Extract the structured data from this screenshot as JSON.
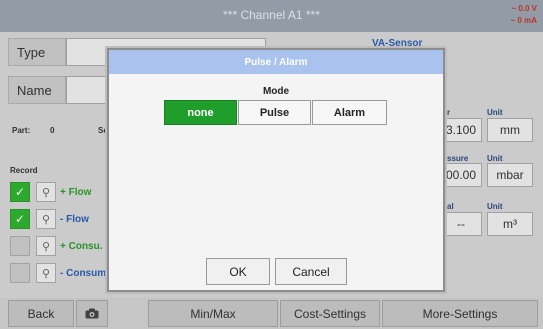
{
  "header": {
    "title": "*** Channel A1 ***",
    "voltage": "~ 0.0 V",
    "current": "~ 0 mA"
  },
  "left": {
    "type_label": "Type",
    "name_label": "Name",
    "part_label": "Part:",
    "part_value": "0",
    "part_suffix": "Se",
    "record_label": "Record",
    "records": [
      {
        "label": "+ Flow",
        "checked": true,
        "color": "#2a9a2a"
      },
      {
        "label": "- Flow",
        "checked": true,
        "color": "#2a5db0"
      },
      {
        "label": "+ Consu.",
        "checked": false,
        "color": "#2a9a2a"
      },
      {
        "label": "- Consum",
        "checked": false,
        "color": "#2a5db0"
      }
    ]
  },
  "right": {
    "sensor": "VA-Sensor",
    "rows": [
      {
        "left_label": "r",
        "unit_label": "Unit",
        "value": "3.100",
        "unit": "mm"
      },
      {
        "left_label": "ssure",
        "unit_label": "Unit",
        "value": "00.00",
        "unit": "mbar"
      },
      {
        "left_label": "al",
        "unit_label": "Unit",
        "value": "--",
        "unit": "m³"
      }
    ]
  },
  "bottom": {
    "back": "Back",
    "camera_icon": "camera-icon",
    "minmax": "Min/Max",
    "cost": "Cost-Settings",
    "more": "More-Settings"
  },
  "modal": {
    "title": "Pulse / Alarm",
    "mode_label": "Mode",
    "options": [
      "none",
      "Pulse",
      "Alarm"
    ],
    "selected": "none",
    "ok": "OK",
    "cancel": "Cancel",
    "colors": {
      "selected": "#1f9e2c",
      "title_bar": "#a9c3ee"
    }
  }
}
